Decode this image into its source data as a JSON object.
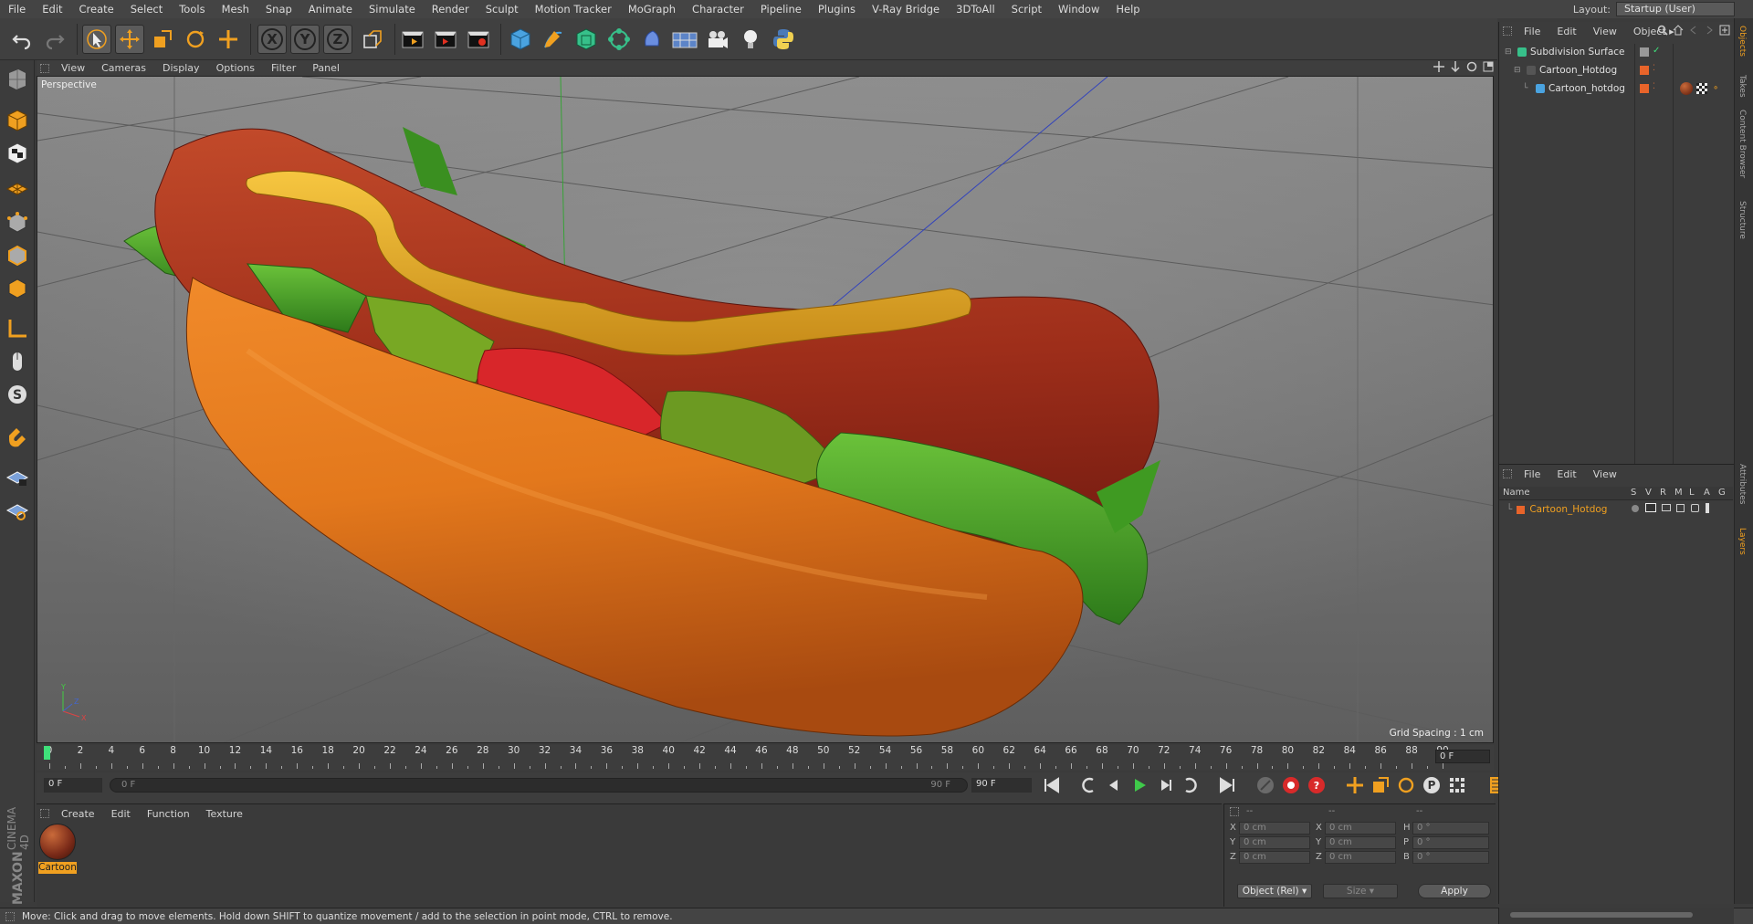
{
  "menubar": {
    "items": [
      "File",
      "Edit",
      "Create",
      "Select",
      "Tools",
      "Mesh",
      "Snap",
      "Animate",
      "Simulate",
      "Render",
      "Sculpt",
      "Motion Tracker",
      "MoGraph",
      "Character",
      "Pipeline",
      "Plugins",
      "V-Ray Bridge",
      "3DToAll",
      "Script",
      "Window",
      "Help"
    ],
    "layout_label": "Layout:",
    "layout_value": "Startup (User)"
  },
  "viewport": {
    "menu": [
      "View",
      "Cameras",
      "Display",
      "Options",
      "Filter",
      "Panel"
    ],
    "camera_label": "Perspective",
    "grid_spacing": "Grid Spacing : 1 cm"
  },
  "timeline": {
    "ticks": [
      "0",
      "2",
      "4",
      "6",
      "8",
      "10",
      "12",
      "14",
      "16",
      "18",
      "20",
      "22",
      "24",
      "26",
      "28",
      "30",
      "32",
      "34",
      "36",
      "38",
      "40",
      "42",
      "44",
      "46",
      "48",
      "50",
      "52",
      "54",
      "56",
      "58",
      "60",
      "62",
      "64",
      "66",
      "68",
      "70",
      "72",
      "74",
      "76",
      "78",
      "80",
      "82",
      "84",
      "86",
      "88",
      "90"
    ],
    "current_frame": "0 F",
    "start_field": "0 F",
    "range_start": "0 F",
    "range_end": "90 F",
    "end_field": "90 F",
    "playhead_fraction": 0.0
  },
  "material_manager": {
    "menu": [
      "Create",
      "Edit",
      "Function",
      "Texture"
    ],
    "material_name": "Cartoon",
    "logo_line1": "MAXON",
    "logo_line2": "CINEMA 4D"
  },
  "coordinates": {
    "header": [
      "--",
      "--",
      "--"
    ],
    "rows": [
      {
        "a": "X",
        "av": "0 cm",
        "b": "X",
        "bv": "0 cm",
        "c": "H",
        "cv": "0 °"
      },
      {
        "a": "Y",
        "av": "0 cm",
        "b": "Y",
        "bv": "0 cm",
        "c": "P",
        "cv": "0 °"
      },
      {
        "a": "Z",
        "av": "0 cm",
        "b": "Z",
        "bv": "0 cm",
        "c": "B",
        "cv": "0 °"
      }
    ],
    "mode": "Object (Rel)",
    "size_mode": "Size",
    "apply": "Apply"
  },
  "object_manager": {
    "menu": [
      "File",
      "Edit",
      "View",
      "Object"
    ],
    "objects": [
      {
        "name": "Subdivision Surface",
        "level": 0
      },
      {
        "name": "Cartoon_Hotdog",
        "level": 1
      },
      {
        "name": "Cartoon_hotdog",
        "level": 2
      }
    ]
  },
  "layer_manager": {
    "menu": [
      "File",
      "Edit",
      "View"
    ],
    "columns": [
      "Name",
      "S",
      "V",
      "R",
      "M",
      "L",
      "A",
      "G"
    ],
    "layers": [
      {
        "name": "Cartoon_Hotdog",
        "color": "#e8642a"
      }
    ]
  },
  "right_tabs": [
    "Objects",
    "Takes",
    "Content Browser",
    "Structure",
    "Attributes",
    "Layers"
  ],
  "status": "Move: Click and drag to move elements. Hold down SHIFT to quantize movement / add to the selection in point mode, CTRL to remove.",
  "colors": {
    "accent": "#f0a020",
    "layer": "#e8642a",
    "playhead": "#3fe07a"
  },
  "icons": {
    "toolbar": [
      "undo-icon",
      "redo-icon",
      "select-icon",
      "move-icon",
      "scale-icon",
      "rotate-icon",
      "last-tool-icon",
      "x-axis-icon",
      "y-axis-icon",
      "z-axis-icon",
      "world-coord-icon",
      "render-view-icon",
      "render-picture-viewer-icon",
      "render-settings-icon",
      "cube-icon",
      "pen-icon",
      "subdivision-icon",
      "array-icon",
      "deformer-icon",
      "floor-icon",
      "camera-icon",
      "light-icon",
      "python-icon"
    ]
  }
}
